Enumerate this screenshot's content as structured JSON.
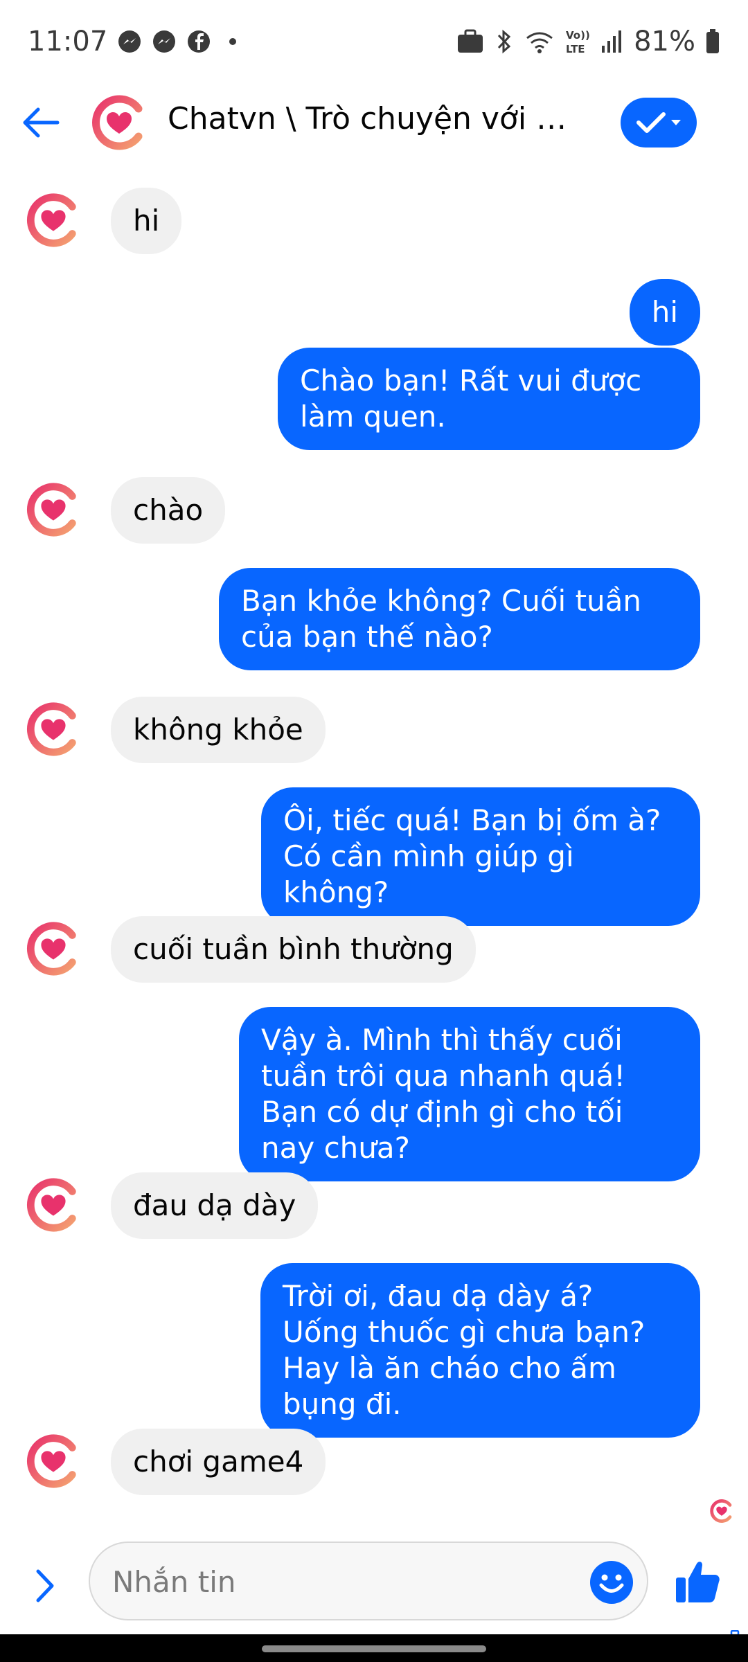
{
  "status_bar": {
    "time": "11:07",
    "battery": "81%",
    "icons": [
      "messenger-icon",
      "messenger-icon",
      "facebook-icon",
      "notification-dot",
      "briefcase-icon",
      "bluetooth-icon",
      "wifi-icon",
      "volte-icon",
      "signal-icon",
      "battery-icon"
    ]
  },
  "header": {
    "title": "Chatvn \\ Trò chuyện với ng...",
    "back_icon": "arrow-left-icon",
    "action_icon": "check-dropdown-icon"
  },
  "messages": [
    {
      "sender": "them",
      "text": "hi"
    },
    {
      "sender": "me",
      "text": "hi"
    },
    {
      "sender": "me",
      "text": "Chào bạn! Rất vui được làm quen."
    },
    {
      "sender": "them",
      "text": "chào"
    },
    {
      "sender": "me",
      "text": "Bạn khỏe không? Cuối tuần của bạn thế nào?"
    },
    {
      "sender": "them",
      "text": "không khỏe"
    },
    {
      "sender": "me",
      "text": "Ôi, tiếc quá! Bạn bị ốm à? Có cần mình giúp gì không?"
    },
    {
      "sender": "them",
      "text": "cuối tuần bình thường"
    },
    {
      "sender": "me",
      "text": "Vậy à. Mình thì thấy cuối tuần trôi qua nhanh quá! Bạn có dự định gì cho tối nay chưa?"
    },
    {
      "sender": "them",
      "text": "đau dạ dày"
    },
    {
      "sender": "me",
      "text": "Trời ơi, đau dạ dày á? Uống thuốc gì chưa bạn? Hay là ăn cháo cho ấm bụng đi."
    },
    {
      "sender": "them",
      "text": "chơi game4"
    }
  ],
  "composer": {
    "placeholder": "Nhắn tin"
  },
  "colors": {
    "accent": "#0866ff",
    "incoming_bubble": "#f0f0f0",
    "logo_pink": "#e8326c",
    "logo_orange": "#f4a070"
  }
}
